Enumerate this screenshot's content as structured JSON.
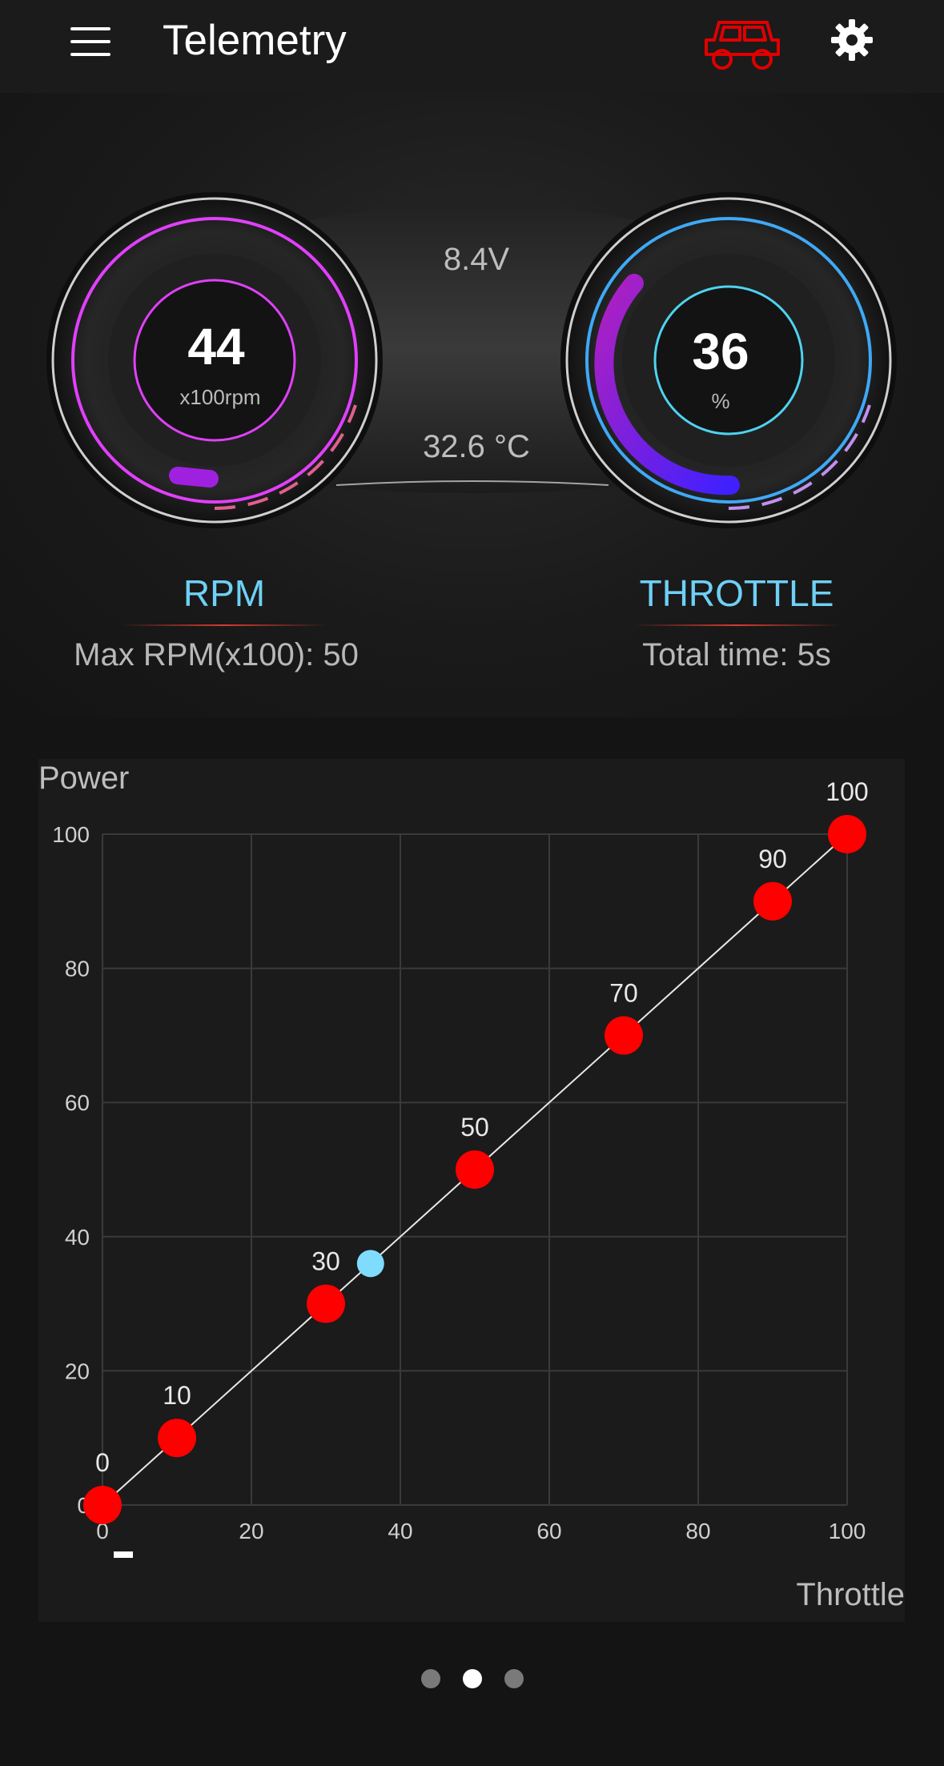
{
  "appbar": {
    "title": "Telemetry"
  },
  "icons": {
    "menu": "menu-icon",
    "vehicle": "jeep-icon",
    "settings": "gear-icon"
  },
  "colors": {
    "accent_red": "#e00000",
    "label_blue": "#6fd0f5",
    "rpm_ring": "#e040fb",
    "throttle_ring": "#3fa9f5",
    "current_point": "#7fdcff"
  },
  "gauges": {
    "rpm": {
      "value": "44",
      "unit": "x100rpm",
      "level": 0.1,
      "label": "RPM",
      "footer": "Max RPM(x100): 50"
    },
    "throttle": {
      "value": "36",
      "unit": "%",
      "level": 0.36,
      "label": "THROTTLE",
      "footer": "Total time: 5s"
    },
    "voltage": "8.4V",
    "temperature": "32.6 °C"
  },
  "chart_data": {
    "type": "line",
    "ylabel": "Power",
    "xlabel": "Throttle",
    "xlim": [
      0,
      100
    ],
    "ylim": [
      0,
      100
    ],
    "x_ticks": [
      "0",
      "20",
      "40",
      "60",
      "80",
      "100"
    ],
    "y_ticks": [
      "0",
      "20",
      "40",
      "60",
      "80",
      "100"
    ],
    "grid": true,
    "series": [
      {
        "x": [
          0,
          10,
          30,
          50,
          70,
          90,
          100
        ],
        "y": [
          0,
          10,
          30,
          50,
          70,
          90,
          100
        ],
        "labels": [
          "0",
          "10",
          "30",
          "50",
          "70",
          "90",
          "100"
        ]
      }
    ],
    "current_point": {
      "x": 36,
      "y": 36
    }
  },
  "pager": {
    "count": 3,
    "active": 1
  }
}
